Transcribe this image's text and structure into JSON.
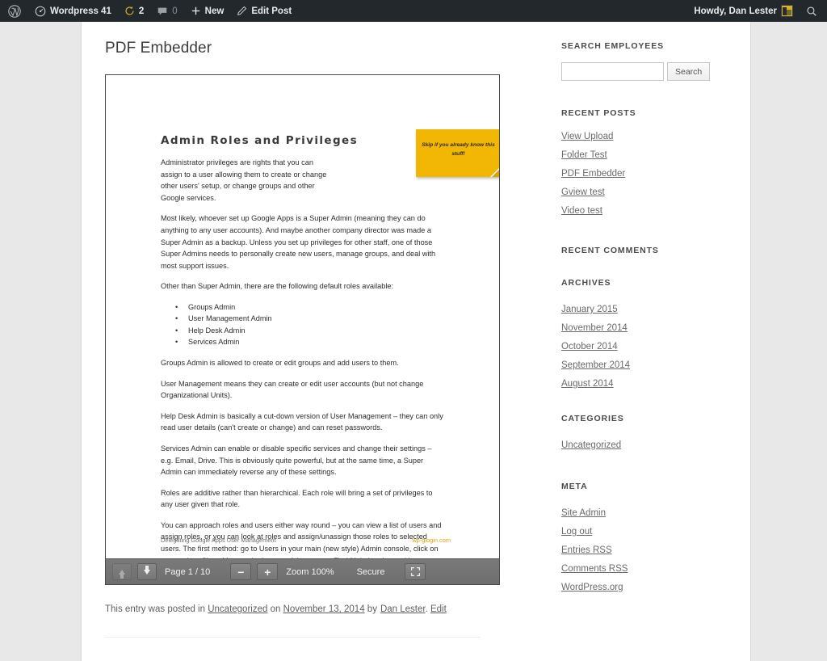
{
  "adminbar": {
    "logo_icon": "wordpress-logo-icon",
    "site_icon": "dashboard-icon",
    "site_name": "Wordpress 41",
    "updates_icon": "updates-icon",
    "updates_count": "2",
    "comments_icon": "comment-bubble-icon",
    "comments_count": "0",
    "new_icon": "plus-icon",
    "new_label": "New",
    "edit_icon": "pencil-icon",
    "edit_label": "Edit Post",
    "howdy": "Howdy, Dan Lester",
    "avatar_icon": "avatar",
    "search_icon": "search-icon"
  },
  "entry": {
    "title": "PDF Embedder",
    "meta_prefix": "This entry was posted in",
    "meta_category": "Uncategorized",
    "meta_on": "on",
    "meta_date": "November 13, 2014",
    "meta_by": "by",
    "meta_author": "Dan Lester",
    "meta_period": ".",
    "meta_edit": "Edit"
  },
  "pdf": {
    "heading": "Admin Roles and Privileges",
    "paragraphs": [
      "Administrator privileges are rights that you can assign to a user allowing them to create or change other users' setup, or change groups and other Google services.",
      "Most likely, whoever set up Google Apps is a Super Admin (meaning they can do anything to any user accounts). And maybe another company director was made a Super Admin as a backup. Unless you set up privileges for other staff, one of those Super Admins needs to personally create new users, manage groups, and deal with most support issues.",
      "Other than Super Admin, there are the following default roles available:"
    ],
    "roles": [
      "Groups Admin",
      "User Management Admin",
      "Help Desk Admin",
      "Services Admin"
    ],
    "paragraphs2": [
      "Groups Admin is allowed to create or edit groups and add users to them.",
      "User Management means they can create or edit user accounts (but not change Organizational Units).",
      "Help Desk Admin is basically a cut-down version of User Management – they can only read user details (can't create or change) and can reset passwords.",
      "Services Admin can enable or disable specific services and change their settings – e.g. Email, Drive. This is obviously quite powerful, but at the same time, a Super Admin can immediately reverse any of these settings.",
      "Roles are additive rather than hierarchical. Each role will bring a set of privileges to any user given that role.",
      "You can approach roles and users either way round – you can view a list of users and assign roles, or you can look at roles and assign/unassign those roles to selected users. The first method: go to Users in your main (new style) Admin console, click on a user, then Show More at the bottom of the screen. Find \"Admin roles and its privileges\"."
    ],
    "sticky_note": "Skip if you already know this stuff!",
    "footer_left": "Delegating Google Apps User Management",
    "footer_right": "wp-glogin.com",
    "colors": {
      "sticky": "#f2b705",
      "footer_right": "#e0a200"
    }
  },
  "toolbar": {
    "prev_icon": "arrow-up-icon",
    "next_icon": "arrow-down-icon",
    "page_label": "Page 1 / 10",
    "zoom_out_icon": "minus-icon",
    "zoom_in_icon": "plus-icon",
    "zoom_label": "Zoom 100%",
    "secure_label": "Secure",
    "fullscreen_icon": "fullscreen-icon"
  },
  "sidebar": {
    "widgets": [
      {
        "title": "Search Employees",
        "type": "search",
        "input_value": "",
        "input_placeholder": "",
        "button_label": "Search"
      },
      {
        "title": "Recent Posts",
        "type": "links",
        "links": [
          "View Upload",
          "Folder Test",
          "PDF Embedder",
          "Gview test",
          "Video test"
        ]
      },
      {
        "title": "Recent Comments",
        "type": "links",
        "links": []
      },
      {
        "title": "Archives",
        "type": "links",
        "links": [
          "January 2015",
          "November 2014",
          "October 2014",
          "September 2014",
          "August 2014"
        ]
      },
      {
        "title": "Categories",
        "type": "links",
        "links": [
          "Uncategorized"
        ]
      },
      {
        "title": "Meta",
        "type": "links",
        "links": [
          "Site Admin",
          "Log out",
          "Entries RSS",
          "Comments RSS",
          "WordPress.org"
        ]
      }
    ]
  }
}
